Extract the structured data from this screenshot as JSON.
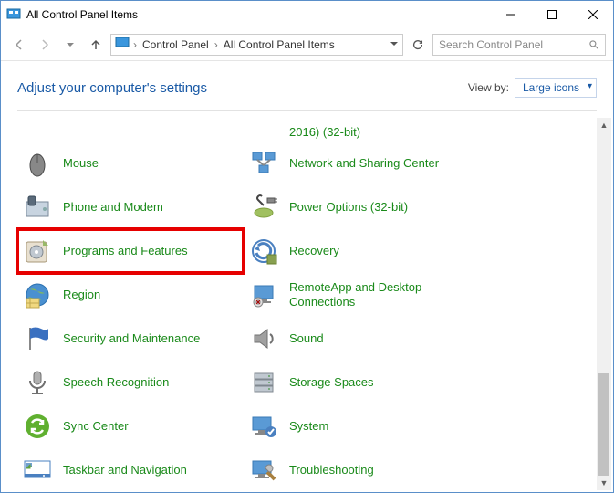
{
  "window": {
    "title": "All Control Panel Items"
  },
  "breadcrumb": {
    "root": "Control Panel",
    "current": "All Control Panel Items"
  },
  "search": {
    "placeholder": "Search Control Panel"
  },
  "header": {
    "title": "Adjust your computer's settings",
    "viewby_label": "View by:",
    "viewby_value": "Large icons"
  },
  "items_cut": {
    "left_label": "",
    "right_label": "2016) (32-bit)"
  },
  "items": {
    "left": [
      {
        "label": "Mouse",
        "icon": "mouse"
      },
      {
        "label": "Phone and Modem",
        "icon": "phone-modem"
      },
      {
        "label": "Programs and Features",
        "icon": "programs",
        "highlighted": true
      },
      {
        "label": "Region",
        "icon": "region"
      },
      {
        "label": "Security and Maintenance",
        "icon": "flag"
      },
      {
        "label": "Speech Recognition",
        "icon": "mic"
      },
      {
        "label": "Sync Center",
        "icon": "sync"
      },
      {
        "label": "Taskbar and Navigation",
        "icon": "taskbar"
      }
    ],
    "right": [
      {
        "label": "Network and Sharing Center",
        "icon": "network"
      },
      {
        "label": "Power Options (32-bit)",
        "icon": "power"
      },
      {
        "label": "Recovery",
        "icon": "recovery"
      },
      {
        "label": "RemoteApp and Desktop Connections",
        "icon": "remoteapp"
      },
      {
        "label": "Sound",
        "icon": "sound"
      },
      {
        "label": "Storage Spaces",
        "icon": "storage"
      },
      {
        "label": "System",
        "icon": "system"
      },
      {
        "label": "Troubleshooting",
        "icon": "troubleshoot"
      }
    ]
  }
}
